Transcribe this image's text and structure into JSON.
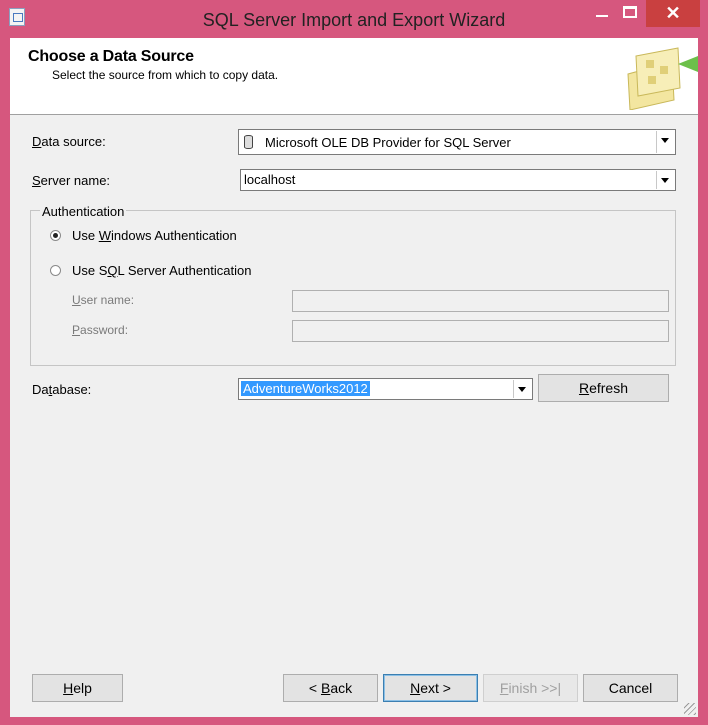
{
  "window": {
    "title": "SQL Server Import and Export Wizard",
    "close_glyph": "✕"
  },
  "header": {
    "title": "Choose a Data Source",
    "subtitle": "Select the source from which to copy data."
  },
  "form": {
    "data_source": {
      "label_prefix": "",
      "label_accel": "D",
      "label_rest": "ata source:",
      "value": "Microsoft OLE DB Provider for SQL Server"
    },
    "server_name": {
      "label_accel": "S",
      "label_rest": "erver name:",
      "value": "localhost"
    },
    "authentication": {
      "group_label": "Authentication",
      "windows": {
        "pre": "Use ",
        "accel": "W",
        "post": "indows Authentication",
        "selected": true
      },
      "sql": {
        "pre": "Use S",
        "accel": "Q",
        "post": "L Server Authentication",
        "selected": false
      },
      "user_name": {
        "accel": "U",
        "rest": "ser name:",
        "value": ""
      },
      "password": {
        "accel": "P",
        "rest": "assword:",
        "value": ""
      }
    },
    "database": {
      "label_pre": "Da",
      "label_accel": "t",
      "label_post": "abase:",
      "value": "AdventureWorks2012"
    },
    "refresh": {
      "accel": "R",
      "rest": "efresh"
    }
  },
  "buttons": {
    "help": {
      "accel": "H",
      "rest": "elp"
    },
    "back": {
      "pre": "< ",
      "accel": "B",
      "rest": "ack"
    },
    "next": {
      "accel": "N",
      "rest": "ext >"
    },
    "finish": {
      "accel": "F",
      "rest": "inish >>|"
    },
    "cancel": {
      "label": "Cancel"
    }
  },
  "colors": {
    "frame": "#d6577e",
    "selection": "#3399ff",
    "close": "#c94040"
  }
}
